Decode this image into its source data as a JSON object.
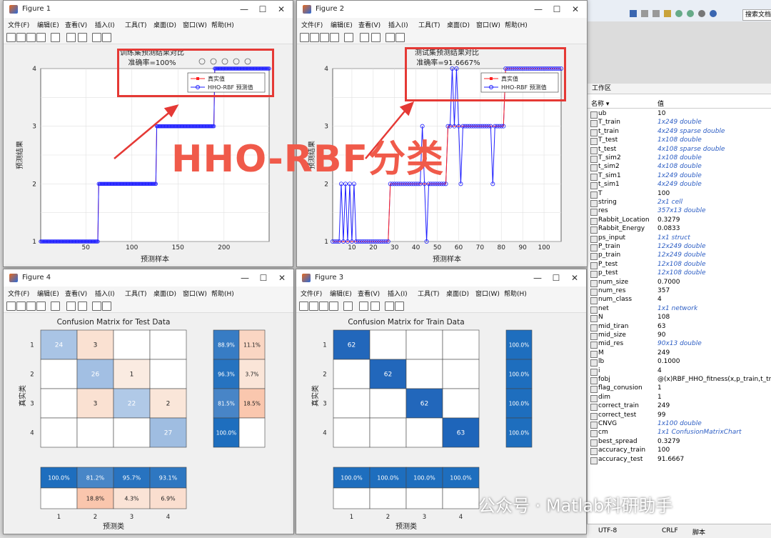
{
  "menu": [
    "文件(F)",
    "编辑(E)",
    "查看(V)",
    "插入(I)",
    "工具(T)",
    "桌面(D)",
    "窗口(W)",
    "帮助(H)"
  ],
  "fig1": {
    "window_title": "Figure 1",
    "title_line1": "训练集预测结果对比",
    "title_line2": "准确率=100%",
    "xlabel": "预测样本",
    "ylabel": "预测结果",
    "legend_true": "真实值",
    "legend_pred": "HHO-RBF 预测值"
  },
  "fig2": {
    "window_title": "Figure 2",
    "title_line1": "测试集预测结果对比",
    "title_line2": "准确率=91.6667%",
    "xlabel": "预测样本",
    "ylabel": "预测结果",
    "legend_true": "真实值",
    "legend_pred": "HHO-RBF 预测值"
  },
  "fig4": {
    "window_title": "Figure 4",
    "title": "Confusion Matrix for Test Data",
    "ylabel": "真实类",
    "xlabel": "预测类"
  },
  "fig3": {
    "window_title": "Figure 3",
    "title": "Confusion Matrix for Train Data",
    "ylabel": "真实类",
    "xlabel": "预测类"
  },
  "overlay_text": "HHO-RBF分类",
  "watermark": "公众号 · Matlab科研助手",
  "chart_data": [
    {
      "type": "line",
      "name": "fig1",
      "xlim": [
        1,
        249
      ],
      "ylim": [
        1,
        4
      ],
      "xticks": [
        50,
        100,
        150,
        200
      ],
      "yticks": [
        1,
        1.5,
        2,
        2.5,
        3,
        3.5,
        4
      ],
      "grid": true,
      "legend": "top-right",
      "segments_true": [
        [
          1,
          63,
          1
        ],
        [
          64,
          126,
          2
        ],
        [
          127,
          189,
          3
        ],
        [
          190,
          249,
          4
        ]
      ],
      "segments_pred": [
        [
          1,
          63,
          1
        ],
        [
          64,
          126,
          2
        ],
        [
          127,
          189,
          3
        ],
        [
          190,
          249,
          4
        ]
      ],
      "colors": {
        "true": "#ff2020",
        "pred": "#2020ff"
      }
    },
    {
      "type": "line",
      "name": "fig2",
      "xlim": [
        1,
        108
      ],
      "ylim": [
        1,
        4
      ],
      "xticks": [
        10,
        20,
        30,
        40,
        50,
        60,
        70,
        80,
        90,
        100
      ],
      "yticks": [
        1,
        1.5,
        2,
        2.5,
        3,
        3.5,
        4
      ],
      "grid": true,
      "legend": "top-right",
      "true_steps": [
        [
          1,
          27,
          1
        ],
        [
          28,
          54,
          2
        ],
        [
          55,
          81,
          3
        ],
        [
          82,
          108,
          4
        ]
      ],
      "pred_spikes": [
        [
          5,
          2
        ],
        [
          7,
          2
        ],
        [
          9,
          2
        ],
        [
          11,
          2
        ],
        [
          43,
          3
        ],
        [
          45,
          1
        ],
        [
          57,
          4
        ],
        [
          59,
          4
        ],
        [
          61,
          2
        ],
        [
          76,
          2
        ]
      ],
      "colors": {
        "true": "#ff2020",
        "pred": "#2020ff"
      }
    },
    {
      "type": "heatmap",
      "name": "confusion_test",
      "row_labels": [
        "1",
        "2",
        "3",
        "4"
      ],
      "col_labels": [
        "1",
        "2",
        "3",
        "4"
      ],
      "matrix": [
        [
          24,
          3,
          null,
          null
        ],
        [
          null,
          26,
          1,
          null
        ],
        [
          null,
          3,
          22,
          2
        ],
        [
          null,
          null,
          null,
          27
        ]
      ],
      "row_summary": [
        [
          "88.9%",
          "11.1%"
        ],
        [
          "96.3%",
          "3.7%"
        ],
        [
          "81.5%",
          "18.5%"
        ],
        [
          "100.0%",
          ""
        ]
      ],
      "col_summary_top": [
        "100.0%",
        "81.2%",
        "95.7%",
        "93.1%"
      ],
      "col_summary_bottom": [
        "",
        "18.8%",
        "4.3%",
        "6.9%"
      ]
    },
    {
      "type": "heatmap",
      "name": "confusion_train",
      "row_labels": [
        "1",
        "2",
        "3",
        "4"
      ],
      "col_labels": [
        "1",
        "2",
        "3",
        "4"
      ],
      "matrix": [
        [
          62,
          null,
          null,
          null
        ],
        [
          null,
          62,
          null,
          null
        ],
        [
          null,
          null,
          62,
          null
        ],
        [
          null,
          null,
          null,
          63
        ]
      ],
      "row_summary": [
        [
          "100.0%"
        ],
        [
          "100.0%"
        ],
        [
          "100.0%"
        ],
        [
          "100.0%"
        ]
      ],
      "col_summary_top": [
        "100.0%",
        "100.0%",
        "100.0%",
        "100.0%"
      ],
      "col_summary_bottom": [
        "",
        "",
        "",
        ""
      ]
    }
  ],
  "workspace": {
    "title": "工作区",
    "col_name": "名称 ▾",
    "col_value": "值",
    "search_placeholder": "搜索文档",
    "rows": [
      {
        "name": "ub",
        "value": "10",
        "italic": false
      },
      {
        "name": "T_train",
        "value": "1x249 double",
        "italic": true
      },
      {
        "name": "t_train",
        "value": "4x249 sparse double",
        "italic": true
      },
      {
        "name": "T_test",
        "value": "1x108 double",
        "italic": true
      },
      {
        "name": "t_test",
        "value": "4x108 sparse double",
        "italic": true
      },
      {
        "name": "T_sim2",
        "value": "1x108 double",
        "italic": true
      },
      {
        "name": "t_sim2",
        "value": "4x108 double",
        "italic": true
      },
      {
        "name": "T_sim1",
        "value": "1x249 double",
        "italic": true
      },
      {
        "name": "t_sim1",
        "value": "4x249 double",
        "italic": true
      },
      {
        "name": "T",
        "value": "100",
        "italic": false
      },
      {
        "name": "string",
        "value": "2x1 cell",
        "italic": true
      },
      {
        "name": "res",
        "value": "357x13 double",
        "italic": true
      },
      {
        "name": "Rabbit_Location",
        "value": "0.3279",
        "italic": false
      },
      {
        "name": "Rabbit_Energy",
        "value": "0.0833",
        "italic": false
      },
      {
        "name": "ps_input",
        "value": "1x1 struct",
        "italic": true
      },
      {
        "name": "P_train",
        "value": "12x249 double",
        "italic": true
      },
      {
        "name": "p_train",
        "value": "12x249 double",
        "italic": true
      },
      {
        "name": "P_test",
        "value": "12x108 double",
        "italic": true
      },
      {
        "name": "p_test",
        "value": "12x108 double",
        "italic": true
      },
      {
        "name": "num_size",
        "value": "0.7000",
        "italic": false
      },
      {
        "name": "num_res",
        "value": "357",
        "italic": false
      },
      {
        "name": "num_class",
        "value": "4",
        "italic": false
      },
      {
        "name": "net",
        "value": "1x1 network",
        "italic": true
      },
      {
        "name": "N",
        "value": "108",
        "italic": false
      },
      {
        "name": "mid_tiran",
        "value": "63",
        "italic": false
      },
      {
        "name": "mid_size",
        "value": "90",
        "italic": false
      },
      {
        "name": "mid_res",
        "value": "90x13 double",
        "italic": true
      },
      {
        "name": "M",
        "value": "249",
        "italic": false
      },
      {
        "name": "lb",
        "value": "0.1000",
        "italic": false
      },
      {
        "name": "i",
        "value": "4",
        "italic": false
      },
      {
        "name": "fobj",
        "value": "@(x)RBF_HHO_fitness(x,p_train,t_train",
        "italic": false
      },
      {
        "name": "flag_conusion",
        "value": "1",
        "italic": false
      },
      {
        "name": "dim",
        "value": "1",
        "italic": false
      },
      {
        "name": "correct_train",
        "value": "249",
        "italic": false
      },
      {
        "name": "correct_test",
        "value": "99",
        "italic": false
      },
      {
        "name": "CNVG",
        "value": "1x100 double",
        "italic": true
      },
      {
        "name": "cm",
        "value": "1x1 ConfusionMatrixChart",
        "italic": true
      },
      {
        "name": "best_spread",
        "value": "0.3279",
        "italic": false
      },
      {
        "name": "accuracy_train",
        "value": "100",
        "italic": false
      },
      {
        "name": "accuracy_test",
        "value": "91.6667",
        "italic": false
      }
    ]
  },
  "status": {
    "encoding": "UTF-8",
    "eol": "CRLF",
    "type": "脚本"
  }
}
